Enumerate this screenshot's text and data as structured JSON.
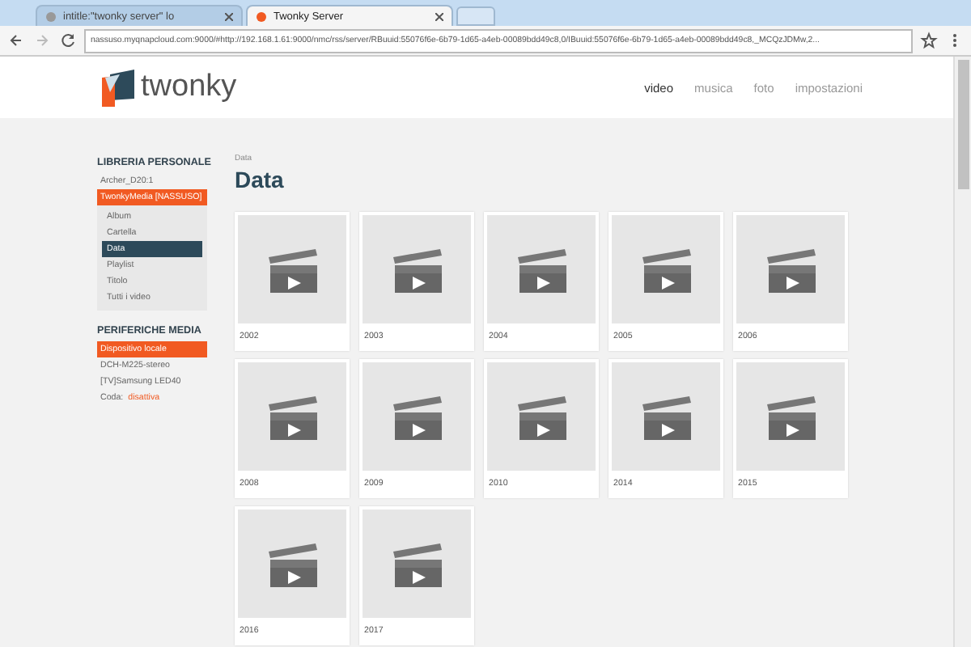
{
  "browser": {
    "tabs": [
      {
        "title": "intitle:\"twonky server\" lo",
        "selected": false
      },
      {
        "title": "Twonky Server",
        "selected": true
      }
    ],
    "url": "nassuso.myqnapcloud.com:9000/#http://192.168.1.61:9000/nmc/rss/server/RBuuid:55076f6e-6b79-1d65-a4eb-00089bdd49c8,0/IBuuid:55076f6e-6b79-1d65-a4eb-00089bdd49c8,_MCQzJDMw,2..."
  },
  "header": {
    "logo_text": "twonky",
    "nav": [
      {
        "label": "video",
        "selected": true
      },
      {
        "label": "musica",
        "selected": false
      },
      {
        "label": "foto",
        "selected": false
      },
      {
        "label": "impostazioni",
        "selected": false
      }
    ]
  },
  "sidebar": {
    "sections": [
      {
        "title": "LIBRERIA PERSONALE",
        "items": [
          {
            "label": "Archer_D20:1",
            "selected": false
          },
          {
            "label": "TwonkyMedia [NASSUSO]",
            "selected": true,
            "children": [
              {
                "label": "Album",
                "selected": false
              },
              {
                "label": "Cartella",
                "selected": false
              },
              {
                "label": "Data",
                "selected": true
              },
              {
                "label": "Playlist",
                "selected": false
              },
              {
                "label": "Titolo",
                "selected": false
              },
              {
                "label": "Tutti i video",
                "selected": false
              }
            ]
          }
        ]
      },
      {
        "title": "PERIFERICHE MEDIA",
        "items": [
          {
            "label": "Dispositivo locale",
            "selected": true
          },
          {
            "label": "DCH-M225-stereo",
            "selected": false
          },
          {
            "label": "[TV]Samsung LED40",
            "selected": false
          }
        ]
      }
    ],
    "queue": {
      "label": "Coda:",
      "status": "disattiva"
    }
  },
  "content": {
    "breadcrumb": "Data",
    "title": "Data",
    "items": [
      "2002",
      "2003",
      "2004",
      "2005",
      "2006",
      "2008",
      "2009",
      "2010",
      "2014",
      "2015",
      "2016",
      "2017"
    ]
  }
}
